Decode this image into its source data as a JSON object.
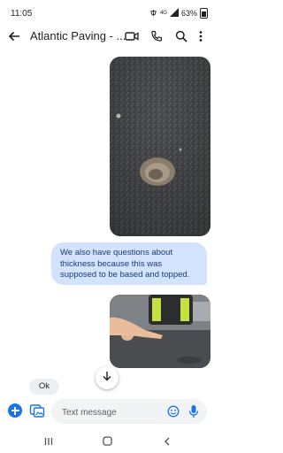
{
  "status_bar": {
    "time": "11:05",
    "battery": "63%",
    "network": "4G"
  },
  "app_bar": {
    "title": "Atlantic Paving - ...",
    "icons": [
      "back-arrow-icon",
      "video-call-icon",
      "phone-icon",
      "search-icon",
      "more-vert-icon"
    ]
  },
  "messages": [
    {
      "type": "image",
      "direction": "outgoing",
      "description_icon": "photo-pothole"
    },
    {
      "type": "text",
      "direction": "outgoing",
      "text": "We also have questions about thickness because this was supposed to be based and topped."
    },
    {
      "type": "image",
      "direction": "outgoing",
      "description_icon": "photo-hand-pointing"
    },
    {
      "type": "text",
      "direction": "incoming",
      "text": "Ok"
    }
  ],
  "composer": {
    "placeholder": "Text message",
    "icons": [
      "add-icon",
      "gallery-icon",
      "emoji-icon",
      "mic-icon"
    ]
  },
  "colors": {
    "accent": "#1a73e8",
    "outgoing_bubble": "#d3e3fd",
    "incoming_bubble": "#eceff1"
  }
}
